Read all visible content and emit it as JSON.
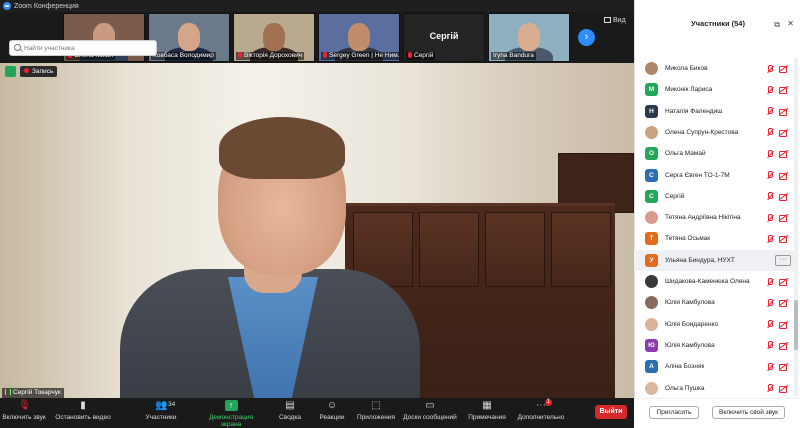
{
  "window": {
    "title": "Zoom Конференция"
  },
  "thumbnails": [
    {
      "name": "Олена Кохан",
      "muted": true,
      "colors": {
        "bg": "#7a5a4a",
        "head": "#c99a80",
        "body": "#2f3f55"
      }
    },
    {
      "name": "Ковбаса Володимир",
      "muted": false,
      "colors": {
        "bg": "#6a7a8a",
        "head": "#d4a58a",
        "body": "#1f2a44"
      }
    },
    {
      "name": "Вікторія Дорохович",
      "muted": true,
      "colors": {
        "bg": "#b9a98f",
        "head": "#a17050",
        "body": "#3a2a28"
      }
    },
    {
      "name": "Sergey Green | Не Ним...",
      "muted": true,
      "colors": {
        "bg": "#5a6fa0",
        "head": "#c08c6c",
        "body": "#30343c"
      }
    },
    {
      "name": "Сергій",
      "muted": true,
      "plain": true,
      "display": "Сергій"
    },
    {
      "name": "Iryna Bandura",
      "muted": false,
      "colors": {
        "bg": "#8fb0c0",
        "head": "#d9ad90",
        "body": "#4a5a6a"
      }
    }
  ],
  "strip": {
    "view_label": "Вид"
  },
  "main_video": {
    "speaker_name": "Сергій Токарчук",
    "record_label": "Запись"
  },
  "toolbar": {
    "items": [
      {
        "label": "Включить звук",
        "icon": "mic-muted-icon"
      },
      {
        "label": "Остановить видео",
        "icon": "video-camera-icon"
      },
      {
        "label": "Участники",
        "icon": "participants-icon",
        "count": "34"
      },
      {
        "label": "Демонстрация экрана",
        "icon": "share-screen-icon"
      },
      {
        "label": "Сводка",
        "icon": "summary-icon"
      },
      {
        "label": "Реакции",
        "icon": "reactions-icon"
      },
      {
        "label": "Приложения",
        "icon": "apps-icon"
      },
      {
        "label": "Доски сообщений",
        "icon": "whiteboard-icon"
      },
      {
        "label": "Примечания",
        "icon": "notes-icon"
      },
      {
        "label": "Дополнительно",
        "icon": "more-icon",
        "badge": "1"
      }
    ],
    "leave_label": "Выйти"
  },
  "panel": {
    "title": "Участники (54)",
    "search_placeholder": "Найти участника",
    "invite_label": "Пригласить",
    "unmute_label": "Включить свой звук",
    "participants": [
      {
        "name": "Микола Биков",
        "avatar": "",
        "color": "#b0866a",
        "photo": true
      },
      {
        "name": "Миконік Лариса",
        "avatar": "М",
        "color": "#23a55a"
      },
      {
        "name": "Наталія Фалендиш",
        "avatar": "Н",
        "color": "#2d3a4e"
      },
      {
        "name": "Олена Супрун-Крестова",
        "avatar": "",
        "color": "#c9a27f",
        "photo": true
      },
      {
        "name": "Ольга Мамай",
        "avatar": "О",
        "color": "#23a55a"
      },
      {
        "name": "Серга Євген ТО-1-7М",
        "avatar": "С",
        "color": "#2a6fb0"
      },
      {
        "name": "Сергій",
        "avatar": "С",
        "color": "#23a55a"
      },
      {
        "name": "Тетяна Андріївна Нікітіна",
        "avatar": "",
        "color": "#d99a8a",
        "photo": true
      },
      {
        "name": "Тетяна Осьмак",
        "avatar": "Т",
        "color": "#e36b1e"
      },
      {
        "name": "Ульяна Биндура, НУХТ",
        "avatar": "У",
        "color": "#e36b1e",
        "highlight": true
      },
      {
        "name": "Шидакова-Каменюка Олена",
        "avatar": "",
        "color": "#3a3a3a",
        "photo": true
      },
      {
        "name": "Юлія Камбулова",
        "avatar": "",
        "color": "#8a6a5a",
        "photo": true
      },
      {
        "name": "Юлія Бондаренко",
        "avatar": "",
        "color": "#d9b29a",
        "photo": true
      },
      {
        "name": "Юлія Камбулова",
        "avatar": "Ю",
        "color": "#8e3ab0"
      },
      {
        "name": "Аліна Бозняк",
        "avatar": "А",
        "color": "#2a6fb0"
      },
      {
        "name": "Ольга Пушка",
        "avatar": "",
        "color": "#d9b8a0",
        "photo": true
      }
    ]
  }
}
